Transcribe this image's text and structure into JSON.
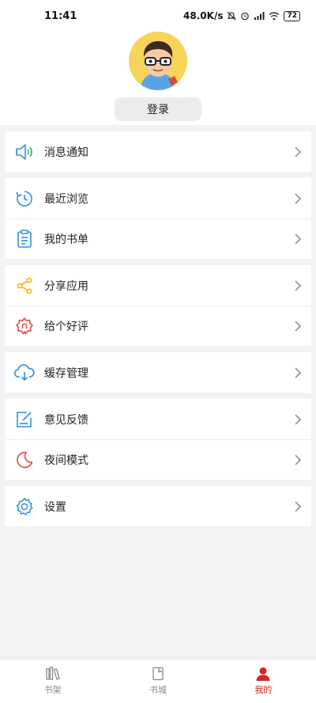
{
  "status_bar": {
    "time": "11:41",
    "net_speed": "48.0K/s",
    "battery": "72"
  },
  "profile": {
    "login_label": "登录"
  },
  "menu": {
    "notifications": "消息通知",
    "recent": "最近浏览",
    "booklist": "我的书单",
    "share": "分享应用",
    "rate": "给个好评",
    "cache": "缓存管理",
    "feedback": "意见反馈",
    "night": "夜间模式",
    "settings": "设置"
  },
  "tabs": {
    "shelf": "书架",
    "store": "书城",
    "mine": "我的"
  },
  "colors": {
    "accent": "#d7251d",
    "icon_blue": "#2f8de4",
    "icon_yellow": "#f0b400",
    "icon_red": "#e0453b",
    "icon_green": "#2bb673"
  }
}
